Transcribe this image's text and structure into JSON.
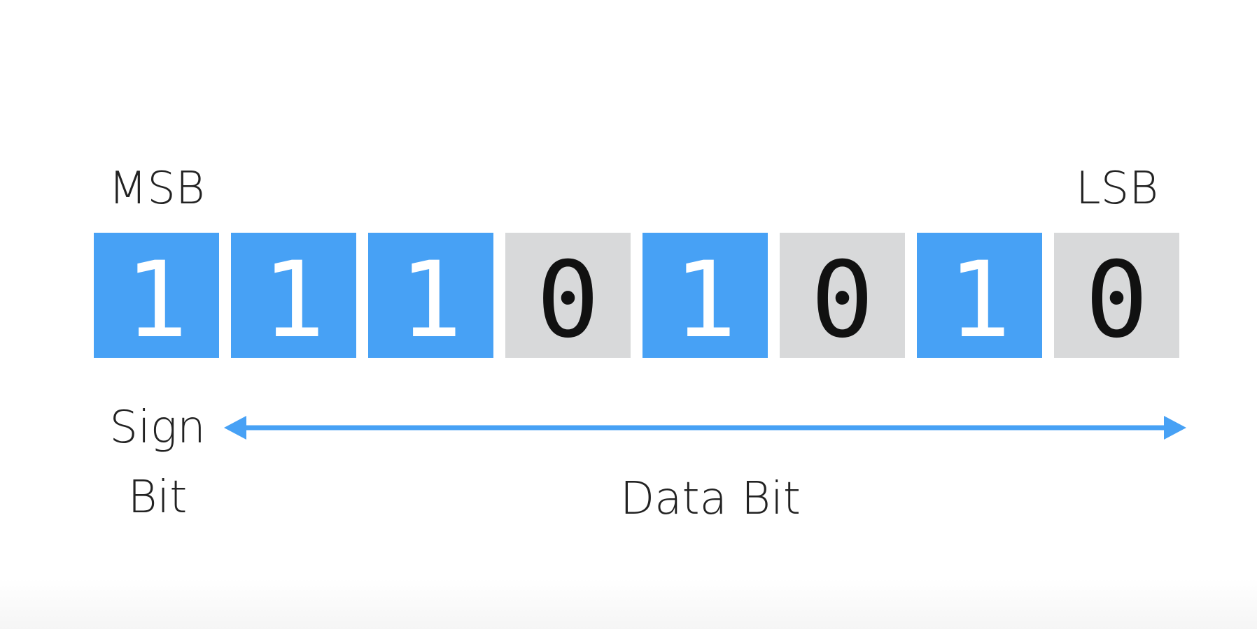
{
  "labels": {
    "msb": "MSB",
    "lsb": "LSB",
    "sign_line1": "Sign",
    "sign_line2": "Bit",
    "data_bit": "Data Bit"
  },
  "bits": [
    "1",
    "1",
    "1",
    "0",
    "1",
    "0",
    "1",
    "0"
  ],
  "colors": {
    "one_bit": "#47a1f5",
    "zero_bit": "#d8d9da",
    "arrow": "#47a1f5"
  }
}
